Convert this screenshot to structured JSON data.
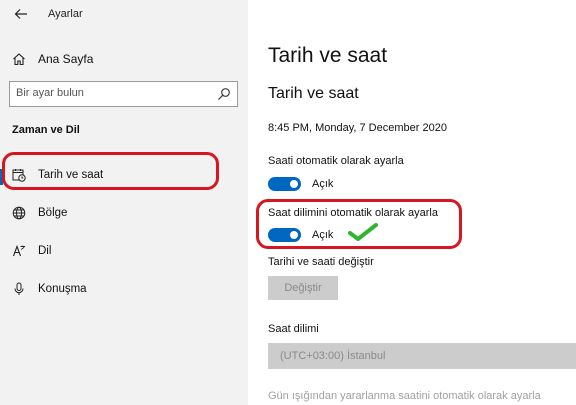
{
  "app": {
    "title": "Ayarlar",
    "back_icon": "back-arrow-icon"
  },
  "sidebar": {
    "home_label": "Ana Sayfa",
    "search_placeholder": "Bir ayar bulun",
    "section_title": "Zaman ve Dil",
    "items": [
      {
        "label": "Tarih ve saat",
        "icon": "calendar-clock-icon",
        "selected": true
      },
      {
        "label": "Bölge",
        "icon": "globe-icon",
        "selected": false
      },
      {
        "label": "Dil",
        "icon": "language-icon",
        "selected": false
      },
      {
        "label": "Konuşma",
        "icon": "microphone-icon",
        "selected": false
      }
    ]
  },
  "main": {
    "page_title": "Tarih ve saat",
    "subtitle": "Tarih ve saat",
    "current_datetime": "8:45 PM, Monday, 7 December 2020",
    "auto_time": {
      "label": "Saati otomatik olarak ayarla",
      "state": "Açık",
      "on": true
    },
    "auto_timezone": {
      "label": "Saat dilimini otomatik olarak ayarla",
      "state": "Açık",
      "on": true
    },
    "change_section": {
      "label": "Tarihi ve saati değiştir",
      "button": "Değiştir"
    },
    "timezone": {
      "label": "Saat dilimi",
      "value": "(UTC+03:00) İstanbul"
    },
    "dst_label": "Gün ışığından yararlanma saatini otomatik olarak ayarla"
  },
  "colors": {
    "accent": "#0067c0",
    "highlight_red": "#d8161f",
    "check_green": "#2fb52f"
  }
}
